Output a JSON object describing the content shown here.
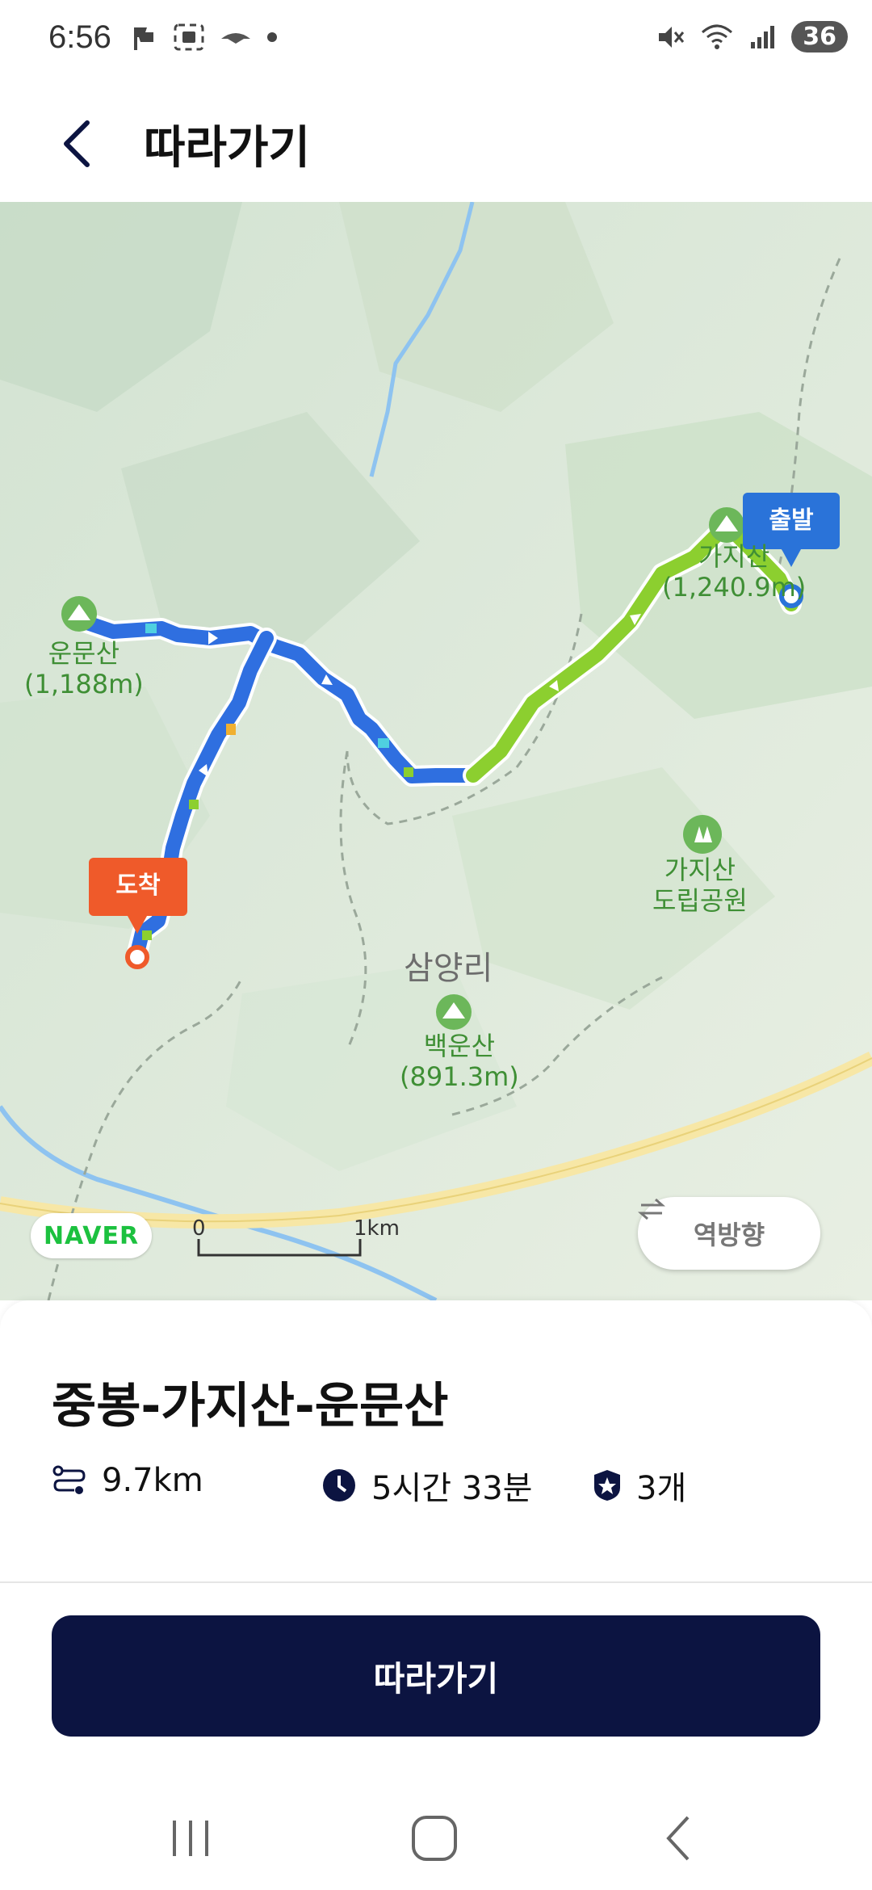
{
  "status": {
    "time": "6:56",
    "battery": "36"
  },
  "header": {
    "title": "따라가기"
  },
  "map": {
    "start_label": "출발",
    "end_label": "도착",
    "peaks": [
      {
        "name": "운문산",
        "elevation": "(1,188m)"
      },
      {
        "name": "가지산",
        "elevation": "(1,240.9m)"
      },
      {
        "name": "백운산",
        "elevation": "(891.3m)"
      }
    ],
    "park_label": "가지산\n도립공원",
    "village_label": "삼양리",
    "provider": "NAVER",
    "scale_start": "0",
    "scale_end": "1km",
    "reverse_label": "역방향",
    "route_color_start": "#8ccf2f",
    "route_color_end": "#2f6fe0"
  },
  "course": {
    "title": "중봉-가지산-운문산",
    "distance": "9.7km",
    "duration": "5시간 33분",
    "badges": "3개"
  },
  "action": {
    "follow_label": "따라가기"
  },
  "icons": {
    "back": "back-arrow-icon",
    "distance": "route-icon",
    "duration": "clock-icon",
    "badges": "badge-star-icon",
    "reverse": "swap-arrows-icon"
  }
}
